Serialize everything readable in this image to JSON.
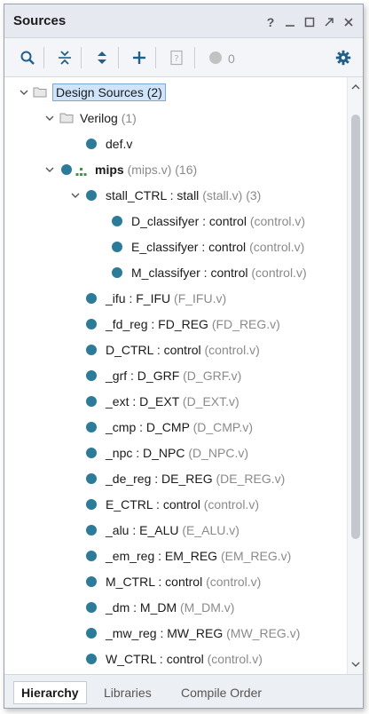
{
  "window": {
    "title": "Sources",
    "help": "?"
  },
  "toolbar": {
    "warning_count": "0"
  },
  "tree": {
    "design_sources": {
      "name": "Design Sources (2)"
    },
    "verilog": {
      "name": "Verilog",
      "count": "(1)"
    },
    "def": {
      "name": "def.v"
    },
    "mips": {
      "name": "mips",
      "file": "(mips.v)",
      "count": "(16)"
    },
    "stall_ctrl": {
      "name": "stall_CTRL : stall",
      "file": "(stall.v)",
      "count": "(3)"
    },
    "children": [
      {
        "name": "D_classifyer : control",
        "file": "(control.v)"
      },
      {
        "name": "E_classifyer : control",
        "file": "(control.v)"
      },
      {
        "name": "M_classifyer : control",
        "file": "(control.v)"
      }
    ],
    "modules": [
      {
        "name": "_ifu : F_IFU",
        "file": "(F_IFU.v)"
      },
      {
        "name": "_fd_reg : FD_REG",
        "file": "(FD_REG.v)"
      },
      {
        "name": "D_CTRL : control",
        "file": "(control.v)"
      },
      {
        "name": "_grf : D_GRF",
        "file": "(D_GRF.v)"
      },
      {
        "name": "_ext : D_EXT",
        "file": "(D_EXT.v)"
      },
      {
        "name": "_cmp : D_CMP",
        "file": "(D_CMP.v)"
      },
      {
        "name": "_npc : D_NPC",
        "file": "(D_NPC.v)"
      },
      {
        "name": "_de_reg : DE_REG",
        "file": "(DE_REG.v)"
      },
      {
        "name": "E_CTRL : control",
        "file": "(control.v)"
      },
      {
        "name": "_alu : E_ALU",
        "file": "(E_ALU.v)"
      },
      {
        "name": "_em_reg : EM_REG",
        "file": "(EM_REG.v)"
      },
      {
        "name": "M_CTRL : control",
        "file": "(control.v)"
      },
      {
        "name": "_dm : M_DM",
        "file": "(M_DM.v)"
      },
      {
        "name": "_mw_reg : MW_REG",
        "file": "(MW_REG.v)"
      },
      {
        "name": "W_CTRL : control",
        "file": "(control.v)"
      }
    ]
  },
  "tabs": [
    {
      "label": "Hierarchy"
    },
    {
      "label": "Libraries"
    },
    {
      "label": "Compile Order"
    }
  ],
  "colors": {
    "accent": "#2b7b99",
    "selection": "#cfe4fb",
    "hierarchy_icon": "#3c9a3c"
  }
}
